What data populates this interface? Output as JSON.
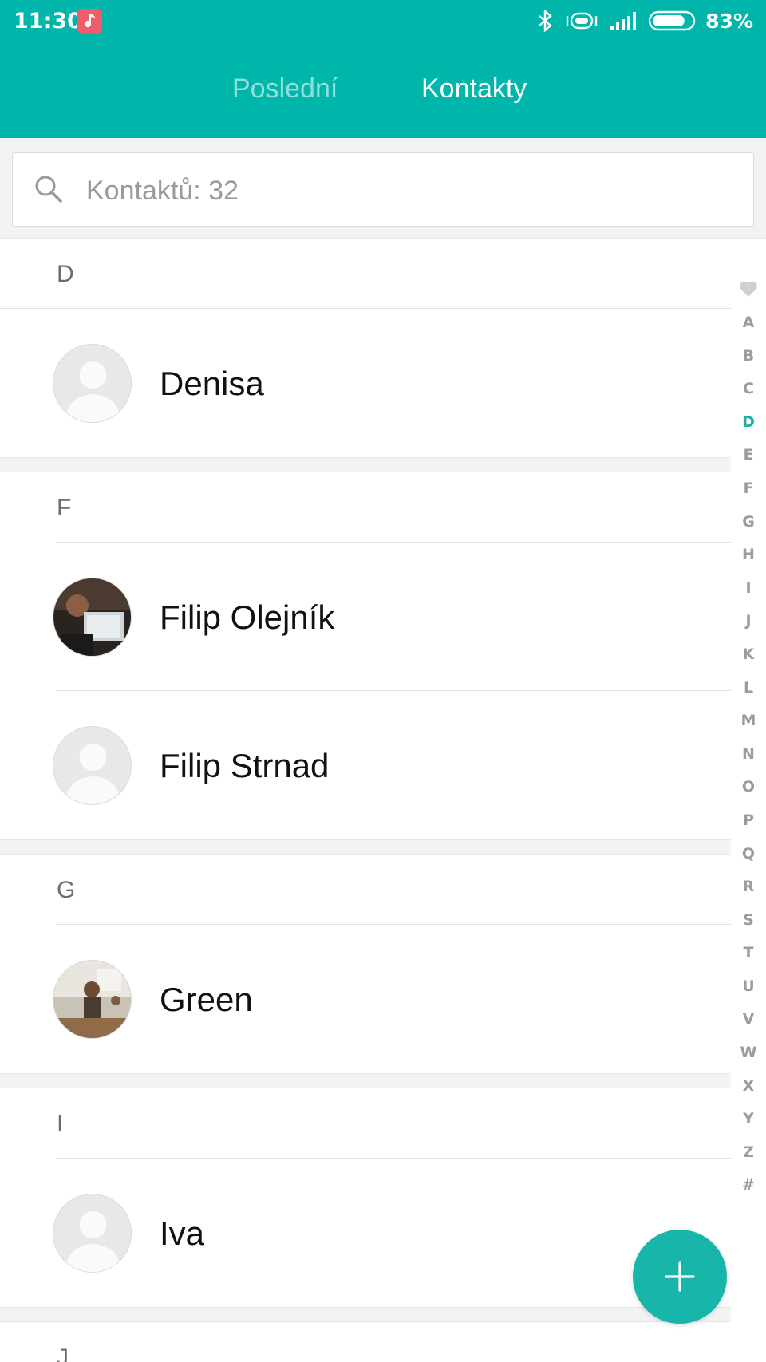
{
  "status_bar": {
    "time": "11:30",
    "battery_percent": "83%",
    "battery_level": 0.83,
    "icons": [
      "music-app-icon",
      "bluetooth-icon",
      "vibrate-icon",
      "signal-icon",
      "battery-icon"
    ]
  },
  "tabs": [
    {
      "label": "Poslední",
      "active": false
    },
    {
      "label": "Kontakty",
      "active": true
    }
  ],
  "search": {
    "placeholder": "Kontaktů: 32",
    "icon": "search-icon"
  },
  "sections": [
    {
      "letter": "D",
      "contacts": [
        {
          "name": "Denisa",
          "avatar": "placeholder"
        }
      ]
    },
    {
      "letter": "F",
      "contacts": [
        {
          "name": "Filip Olejník",
          "avatar": "photo"
        },
        {
          "name": "Filip Strnad",
          "avatar": "placeholder"
        }
      ]
    },
    {
      "letter": "G",
      "contacts": [
        {
          "name": "Green",
          "avatar": "photo"
        }
      ]
    },
    {
      "letter": "I",
      "contacts": [
        {
          "name": "Iva",
          "avatar": "placeholder"
        }
      ]
    },
    {
      "letter": "J",
      "contacts": []
    }
  ],
  "alpha_index": {
    "favorites_icon": "heart-icon",
    "letters": [
      "A",
      "B",
      "C",
      "D",
      "E",
      "F",
      "G",
      "H",
      "I",
      "J",
      "K",
      "L",
      "M",
      "N",
      "O",
      "P",
      "Q",
      "R",
      "S",
      "T",
      "U",
      "V",
      "W",
      "X",
      "Y",
      "Z",
      "#"
    ],
    "active": "D"
  },
  "fab": {
    "icon": "plus-icon"
  },
  "colors": {
    "accent": "#00b5a9",
    "tab_inactive": "#8ee0d9",
    "index_active": "#19b0a6",
    "index_inactive": "#9c9c9c"
  }
}
